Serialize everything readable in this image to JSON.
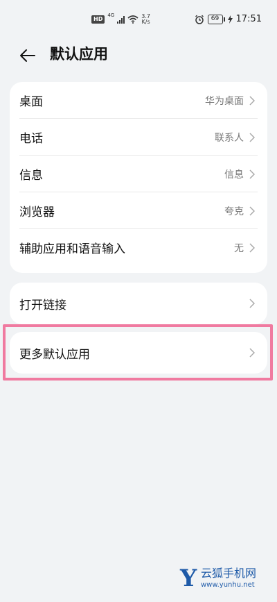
{
  "status_bar": {
    "hd": "HD",
    "network": "4G",
    "speed_value": "3.7",
    "speed_unit": "K/s",
    "battery": "69",
    "time": "17:51"
  },
  "header": {
    "title": "默认应用"
  },
  "group1": {
    "items": [
      {
        "label": "桌面",
        "value": "华为桌面"
      },
      {
        "label": "电话",
        "value": "联系人"
      },
      {
        "label": "信息",
        "value": "信息"
      },
      {
        "label": "浏览器",
        "value": "夸克"
      },
      {
        "label": "辅助应用和语音输入",
        "value": "无"
      }
    ]
  },
  "group2": {
    "open_links": "打开链接"
  },
  "group3": {
    "more_default_apps": "更多默认应用"
  },
  "colors": {
    "background": "#f1f3f5",
    "card": "#ffffff",
    "highlight": "#f07aa0",
    "watermark": "#1e5aa8"
  },
  "icons": [
    "back-arrow-icon",
    "chevron-right-icon",
    "wifi-icon",
    "alarm-icon",
    "battery-icon",
    "charging-icon"
  ],
  "watermark": {
    "letter": "Y",
    "name": "云狐手机网",
    "url": "www.yunhu.net"
  }
}
